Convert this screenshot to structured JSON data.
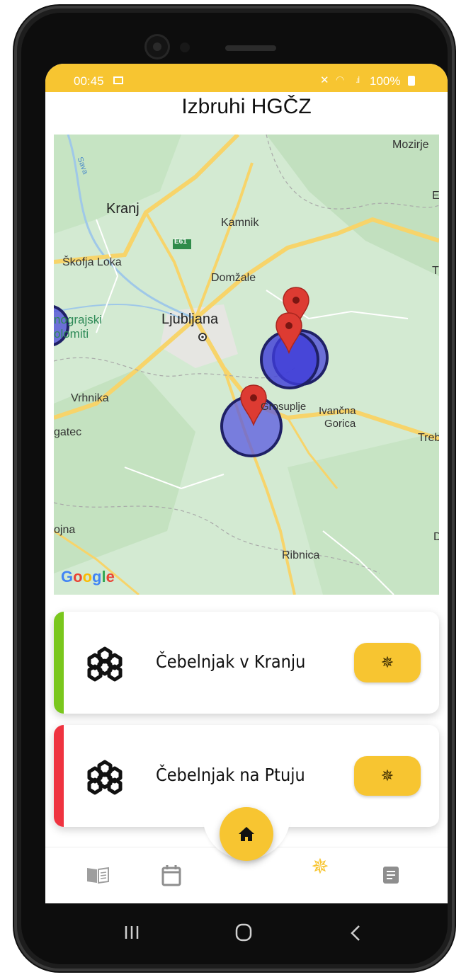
{
  "status_bar": {
    "time": "00:45",
    "battery": "100%",
    "icons": [
      "image-icon",
      "mute-icon",
      "wifi-icon",
      "signal-icon",
      "battery-icon"
    ]
  },
  "header": {
    "title": "Izbruhi HGČZ"
  },
  "map": {
    "labels": {
      "mozirje": "Mozirje",
      "kranj": "Kranj",
      "kamnik": "Kamnik",
      "e61": "E61",
      "e_right": "E",
      "t_right": "T",
      "skofja_loka": "Škofja Loka",
      "domzale": "Domžale",
      "ljubljana": "Ljubljana",
      "nograjski": "nograjski",
      "olomiti": "olomiti",
      "vrhnika": "Vrhnika",
      "ivancna": "Ivančna",
      "gorica": "Gorica",
      "grosuplje": "Grosuplje",
      "gatec": "gatec",
      "treb": "Treb",
      "ojna": "ojna",
      "d_right": "D",
      "ribnica": "Ribnica",
      "sava": "Sava"
    },
    "attribution": "Google",
    "markers": 3,
    "outbreak_circles": 3
  },
  "cards": [
    {
      "label": "Čebelnjak v Kranju",
      "accent_color": "#7ac71d",
      "icon": "beehive-icon",
      "action_icon": "virus-icon"
    },
    {
      "label": "Čebelnjak na Ptuju",
      "accent_color": "#ef3340",
      "icon": "beehive-icon",
      "action_icon": "virus-icon"
    }
  ],
  "bottom_nav": {
    "items": [
      "book-icon",
      "calendar-icon",
      "home-icon",
      "virus-icon",
      "notes-icon"
    ],
    "active": "virus-icon"
  },
  "system_nav": [
    "recents-button",
    "home-button",
    "back-button"
  ],
  "colors": {
    "accent": "#f7c531",
    "marker": "#dd3b32",
    "circle": "#4846d8"
  }
}
